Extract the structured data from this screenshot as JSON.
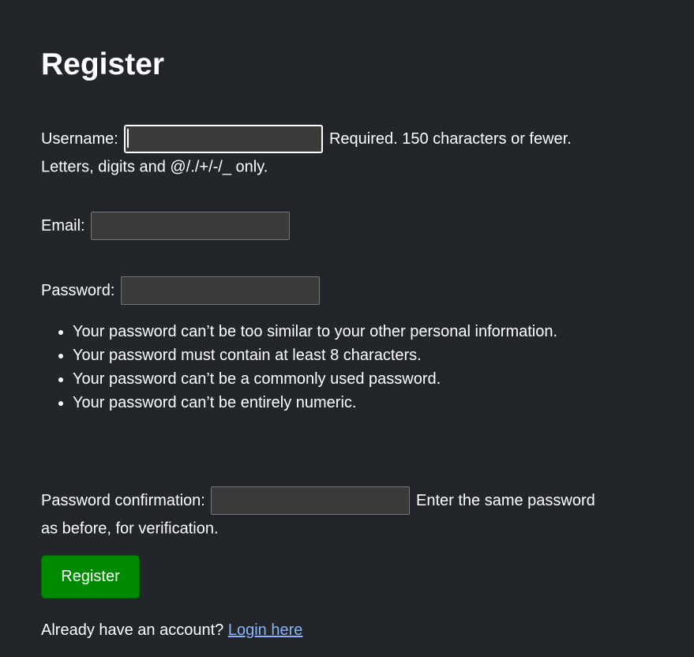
{
  "page_title": "Register",
  "form": {
    "username": {
      "label": "Username:",
      "value": "",
      "help": "Required. 150 characters or fewer. Letters, digits and @/./+/-/_ only."
    },
    "email": {
      "label": "Email:",
      "value": ""
    },
    "password": {
      "label": "Password:",
      "value": "",
      "rules": [
        "Your password can’t be too similar to your other personal information.",
        "Your password must contain at least 8 characters.",
        "Your password can’t be a commonly used password.",
        "Your password can’t be entirely numeric."
      ]
    },
    "password_confirmation": {
      "label": "Password confirmation:",
      "value": "",
      "help": "Enter the same password as before, for verification."
    },
    "submit_label": "Register"
  },
  "footer": {
    "text": "Already have an account?",
    "link_label": "Login here"
  },
  "colors": {
    "background": "#22252a",
    "input_background": "#3a3a3a",
    "button": "#008a00",
    "link": "#8ab4f8"
  }
}
